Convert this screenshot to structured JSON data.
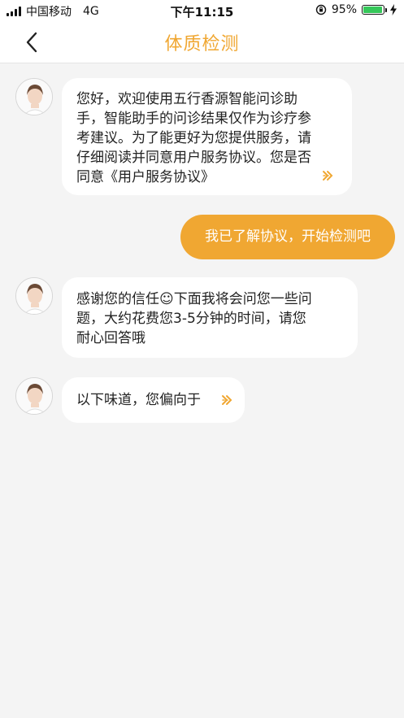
{
  "status_bar": {
    "carrier": "中国移动",
    "network": "4G",
    "time": "下午11:15",
    "battery_percent": "95%",
    "battery_level": 0.95,
    "battery_color": "#35c759"
  },
  "nav": {
    "back_icon": "chevron-left-icon",
    "title": "体质检测",
    "title_color": "#f0a732"
  },
  "messages": [
    {
      "from": "assistant",
      "text": "您好，欢迎使用五行香源智能问诊助手，智能助手的问诊结果仅作为诊疗参考建议。为了能更好为您提供服务，请仔细阅读并同意用户服务协议。您是否同意《用户服务协议》",
      "lines": [
        "您好，欢迎使用五行香源智能问诊助",
        "手，智能助手的问诊结果仅作为诊疗参",
        "考建议。为了能更好为您提供服务，请",
        "仔细阅读并同意用户服务协议。您是否",
        "同意《用户服务协议》"
      ],
      "has_link_arrow": true
    },
    {
      "from": "user",
      "text": "我已了解协议，开始检测吧"
    },
    {
      "from": "assistant",
      "lines": [
        "感谢您的信任☺下面我将会问您一些问",
        "题，大约花费您3-5分钟的时间，请您",
        "耐心回答哦"
      ],
      "has_link_arrow": false
    },
    {
      "from": "assistant",
      "lines": [
        "以下味道，您偏向于"
      ],
      "has_link_arrow": true
    }
  ],
  "accent_color": "#f0a732"
}
